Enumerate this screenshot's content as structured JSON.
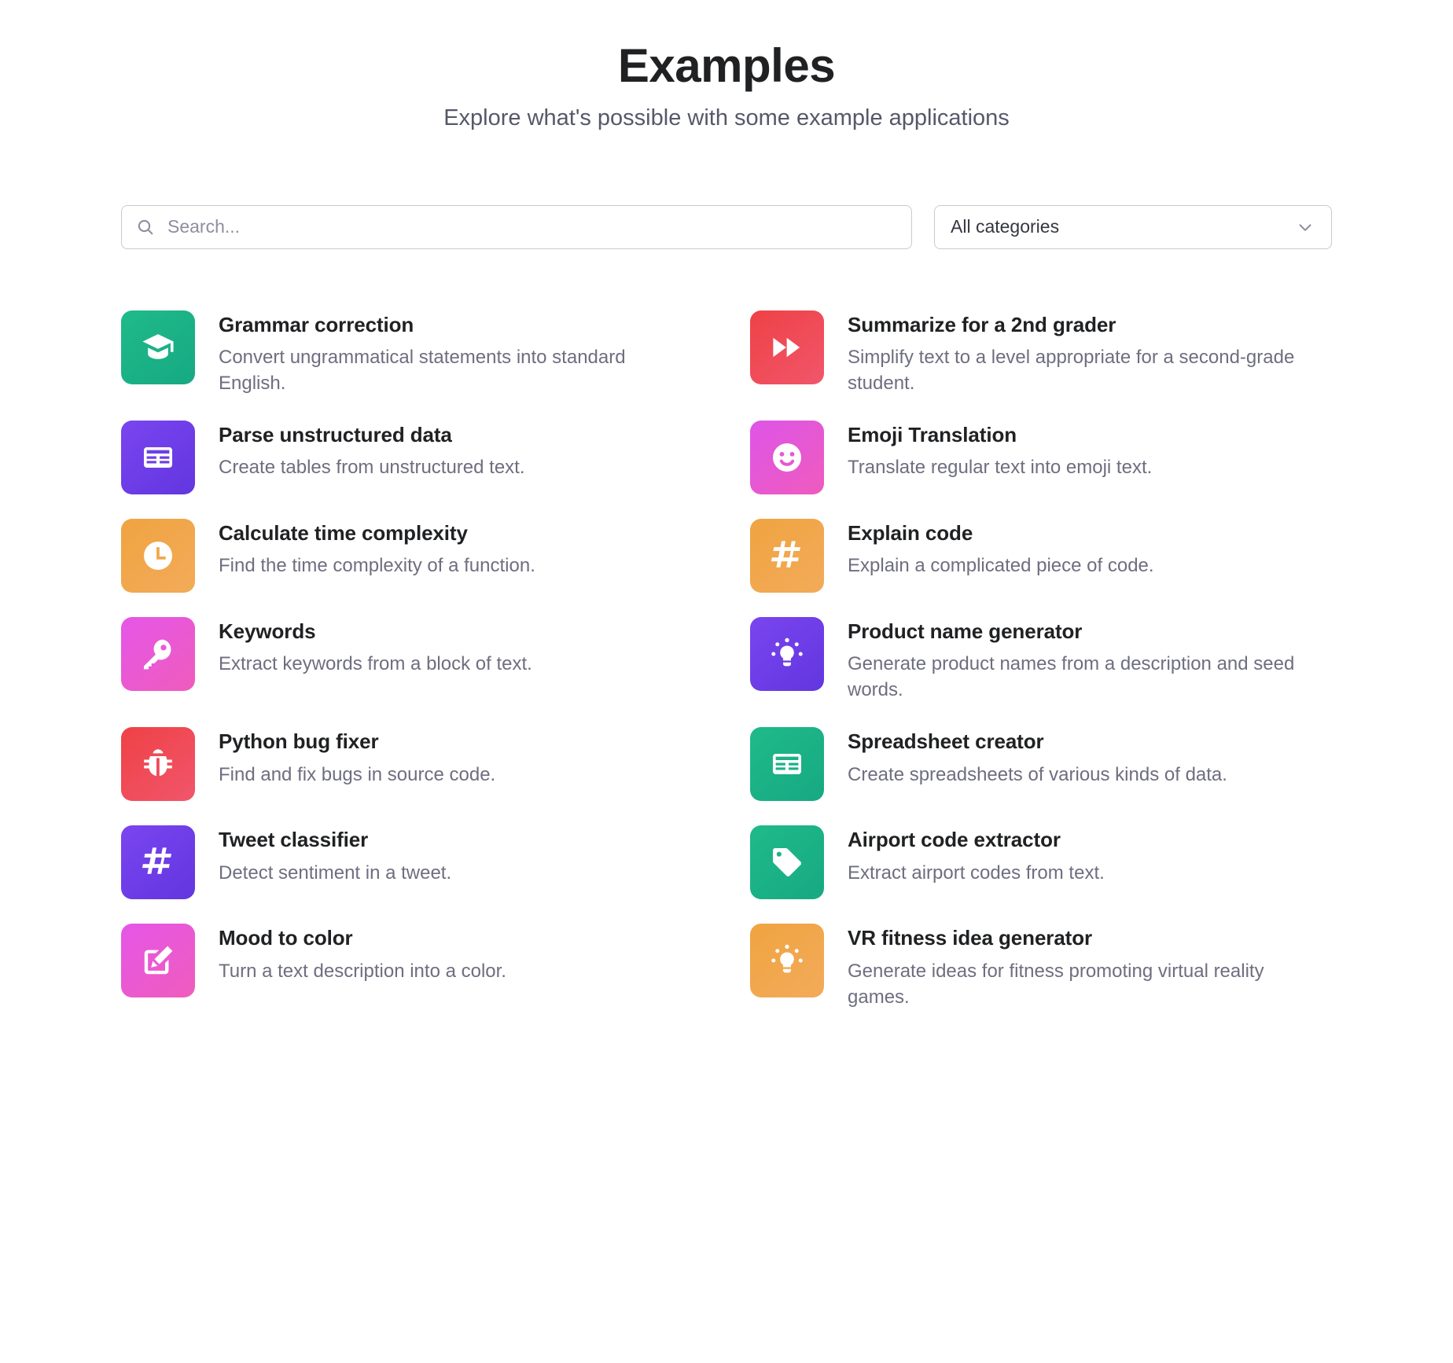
{
  "header": {
    "title": "Examples",
    "subtitle": "Explore what's possible with some example applications"
  },
  "search": {
    "placeholder": "Search...",
    "value": "",
    "icon": "search-icon"
  },
  "category_filter": {
    "selected": "All categories",
    "icon": "chevron-down-icon"
  },
  "colors": {
    "green": "#10a37f",
    "green_light": "#2fc08a",
    "red": "#ef4146",
    "red_light": "#f25f6b",
    "purple": "#6b40e3",
    "purple_light": "#7c4ff0",
    "pink": "#e652cf",
    "pink_light": "#f05cc0",
    "orange": "#f0a14b",
    "orange_light": "#f2ab54",
    "title_text": "#202123",
    "body_text": "#6e6e80",
    "border": "#c9c9d4"
  },
  "examples": [
    {
      "title": "Grammar correction",
      "description": "Convert ungrammatical statements into standard English.",
      "icon": "graduation-cap-icon",
      "color_start": "#1fba8a",
      "color_end": "#17a982"
    },
    {
      "title": "Summarize for a 2nd grader",
      "description": "Simplify text to a level appropriate for a second-grade student.",
      "icon": "fast-forward-icon",
      "color_start": "#ef4146",
      "color_end": "#f0566b"
    },
    {
      "title": "Parse unstructured data",
      "description": "Create tables from unstructured text.",
      "icon": "table-icon",
      "color_start": "#7a45ef",
      "color_end": "#6236e0"
    },
    {
      "title": "Emoji Translation",
      "description": "Translate regular text into emoji text.",
      "icon": "smiley-face-icon",
      "color_start": "#dd55e8",
      "color_end": "#ef5bbd"
    },
    {
      "title": "Calculate time complexity",
      "description": "Find the time complexity of a function.",
      "icon": "clock-icon",
      "color_start": "#f0a340",
      "color_end": "#f2ab5a"
    },
    {
      "title": "Explain code",
      "description": "Explain a complicated piece of code.",
      "icon": "hash-icon",
      "color_start": "#f0a340",
      "color_end": "#f2ab5a"
    },
    {
      "title": "Keywords",
      "description": "Extract keywords from a block of text.",
      "icon": "key-icon",
      "color_start": "#e556e8",
      "color_end": "#ef5cbc"
    },
    {
      "title": "Product name generator",
      "description": "Generate product names from a description and seed words.",
      "icon": "lightbulb-icon",
      "color_start": "#7a45ef",
      "color_end": "#6236e0"
    },
    {
      "title": "Python bug fixer",
      "description": "Find and fix bugs in source code.",
      "icon": "bug-icon",
      "color_start": "#ef4146",
      "color_end": "#f0566b"
    },
    {
      "title": "Spreadsheet creator",
      "description": "Create spreadsheets of various kinds of data.",
      "icon": "spreadsheet-icon",
      "color_start": "#1fba8a",
      "color_end": "#17a982"
    },
    {
      "title": "Tweet classifier",
      "description": "Detect sentiment in a tweet.",
      "icon": "hash-icon",
      "color_start": "#7a45ef",
      "color_end": "#6236e0"
    },
    {
      "title": "Airport code extractor",
      "description": "Extract airport codes from text.",
      "icon": "tag-icon",
      "color_start": "#1fba8a",
      "color_end": "#17a982"
    },
    {
      "title": "Mood to color",
      "description": "Turn a text description into a color.",
      "icon": "edit-icon",
      "color_start": "#e556e8",
      "color_end": "#ef5cbc"
    },
    {
      "title": "VR fitness idea generator",
      "description": "Generate ideas for fitness promoting virtual reality games.",
      "icon": "lightbulb-icon",
      "color_start": "#f0a340",
      "color_end": "#f2ab5a"
    }
  ]
}
